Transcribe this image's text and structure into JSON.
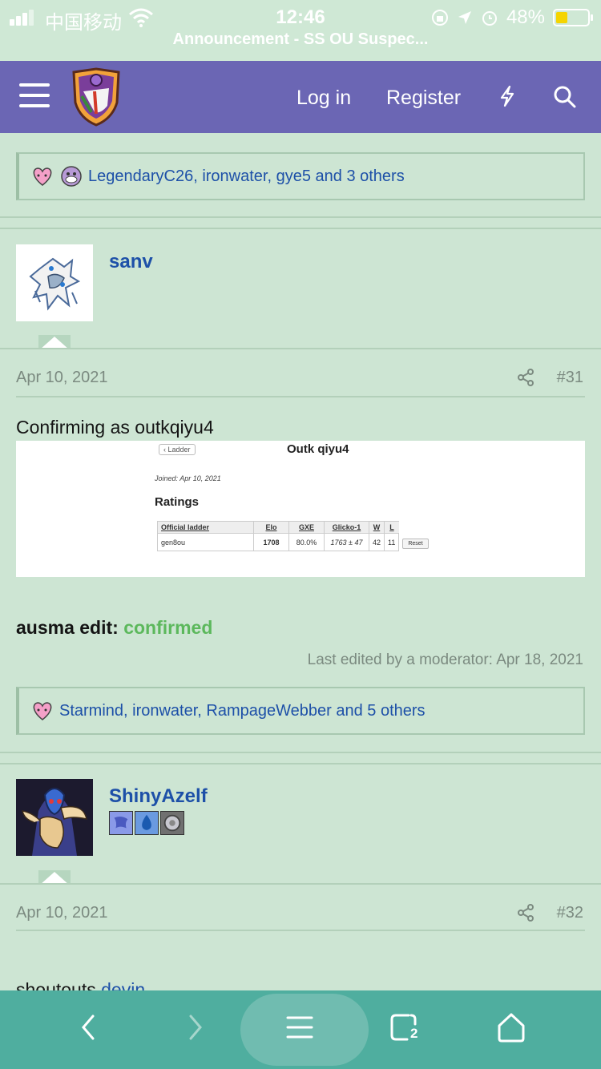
{
  "status_bar": {
    "carrier": "中国移动",
    "time": "12:46",
    "battery": "48%",
    "battery_level": 0.48,
    "announcement": "Announcement - SS OU Suspec..."
  },
  "nav": {
    "login": "Log in",
    "register": "Register",
    "icons": [
      "menu-icon",
      "site-logo",
      "bolt-icon",
      "search-icon"
    ]
  },
  "reactions_top": {
    "text": "LegendaryC26, ironwater, gye5 and 3 others",
    "icons": [
      "heart-reaction-icon",
      "koffing-reaction-icon"
    ]
  },
  "post31": {
    "username": "sanv",
    "date": "Apr 10, 2021",
    "number": "#31",
    "body": "Confirming as outkqiyu4",
    "image": {
      "back_label": "Ladder",
      "player": "Outk qiyu4",
      "joined": "Joined: Apr 10, 2021",
      "ratings_title": "Ratings",
      "headers": [
        "Official ladder",
        "Elo",
        "GXE",
        "Glicko-1",
        "W",
        "L"
      ],
      "row": [
        "gen8ou",
        "1708",
        "80.0%",
        "1763 ± 47",
        "42",
        "11"
      ],
      "reset_label": "Reset"
    },
    "edit_label": "ausma edit: ",
    "edit_status": "confirmed",
    "last_edited": "Last edited by a moderator: Apr 18, 2021",
    "reactions": "Starmind, ironwater, RampageWebber and 5 others"
  },
  "post32": {
    "username": "ShinyAzelf",
    "date": "Apr 10, 2021",
    "number": "#32",
    "body_partial": "shoutouts ",
    "body_link": "devin"
  },
  "bottom_bar": {
    "tab_count": "2",
    "icons": [
      "back-icon",
      "forward-icon",
      "menu-icon",
      "tabs-icon",
      "home-icon"
    ]
  }
}
